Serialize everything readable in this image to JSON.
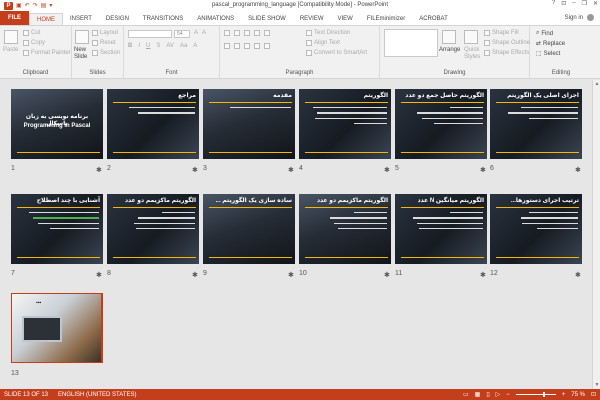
{
  "window": {
    "title": "pascal_programming_language [Compatibility Mode] - PowerPoint",
    "help": "?",
    "minimize": "–",
    "restore": "❐",
    "close": "✕"
  },
  "tabs": [
    {
      "label": "FILE"
    },
    {
      "label": "HOME"
    },
    {
      "label": "INSERT"
    },
    {
      "label": "DESIGN"
    },
    {
      "label": "TRANSITIONS"
    },
    {
      "label": "ANIMATIONS"
    },
    {
      "label": "SLIDE SHOW"
    },
    {
      "label": "REVIEW"
    },
    {
      "label": "VIEW"
    },
    {
      "label": "FILEminimizer"
    },
    {
      "label": "ACROBAT"
    }
  ],
  "signin": "Sign in",
  "ribbon": {
    "clipboard": {
      "label": "Clipboard",
      "paste": "Paste",
      "cut": "Cut",
      "copy": "Copy",
      "format_painter": "Format Painter"
    },
    "slides": {
      "label": "Slides",
      "new_slide": "New",
      "new_slide2": "Slide",
      "layout": "Layout",
      "reset": "Reset",
      "section": "Section"
    },
    "font": {
      "label": "Font",
      "size": "54"
    },
    "paragraph": {
      "label": "Paragraph",
      "text_direction": "Text Direction",
      "align_text": "Align Text",
      "smartart": "Convert to SmartArt"
    },
    "drawing": {
      "label": "Drawing",
      "arrange": "Arrange",
      "quick_styles": "Quick",
      "quick_styles2": "Styles",
      "shape_fill": "Shape Fill",
      "shape_outline": "Shape Outline",
      "shape_effects": "Shape Effects"
    },
    "editing": {
      "label": "Editing",
      "find": "Find",
      "replace": "Replace",
      "select": "Select"
    }
  },
  "slides": [
    {
      "n": "1",
      "title": "",
      "line1": "برنامه نویسی به زبان پاسکال",
      "line2": "Programming in Pascal"
    },
    {
      "n": "2",
      "title": "مراجع"
    },
    {
      "n": "3",
      "title": "مقدمه"
    },
    {
      "n": "4",
      "title": "الگوریتم"
    },
    {
      "n": "5",
      "title": "الگوریتم حاصل جمع دو عدد"
    },
    {
      "n": "6",
      "title": "اجزای اصلی یک الگوریتم"
    },
    {
      "n": "7",
      "title": "آشنایی با چند اصطلاح"
    },
    {
      "n": "8",
      "title": "الگوریتم ماکزیمم دو عدد"
    },
    {
      "n": "9",
      "title": "ساده سازی یک الگوریتم ..."
    },
    {
      "n": "10",
      "title": "الگوریتم ماکزیمم دو عدد"
    },
    {
      "n": "11",
      "title": "الگوریتم میانگین N عدد"
    },
    {
      "n": "12",
      "title": "ترتیب اجرای دستورها..."
    },
    {
      "n": "13",
      "title": ""
    }
  ],
  "star": "✱",
  "status": {
    "slide": "SLIDE 13 OF 13",
    "lang": "ENGLISH (UNITED STATES)",
    "zoom": "75 %"
  }
}
